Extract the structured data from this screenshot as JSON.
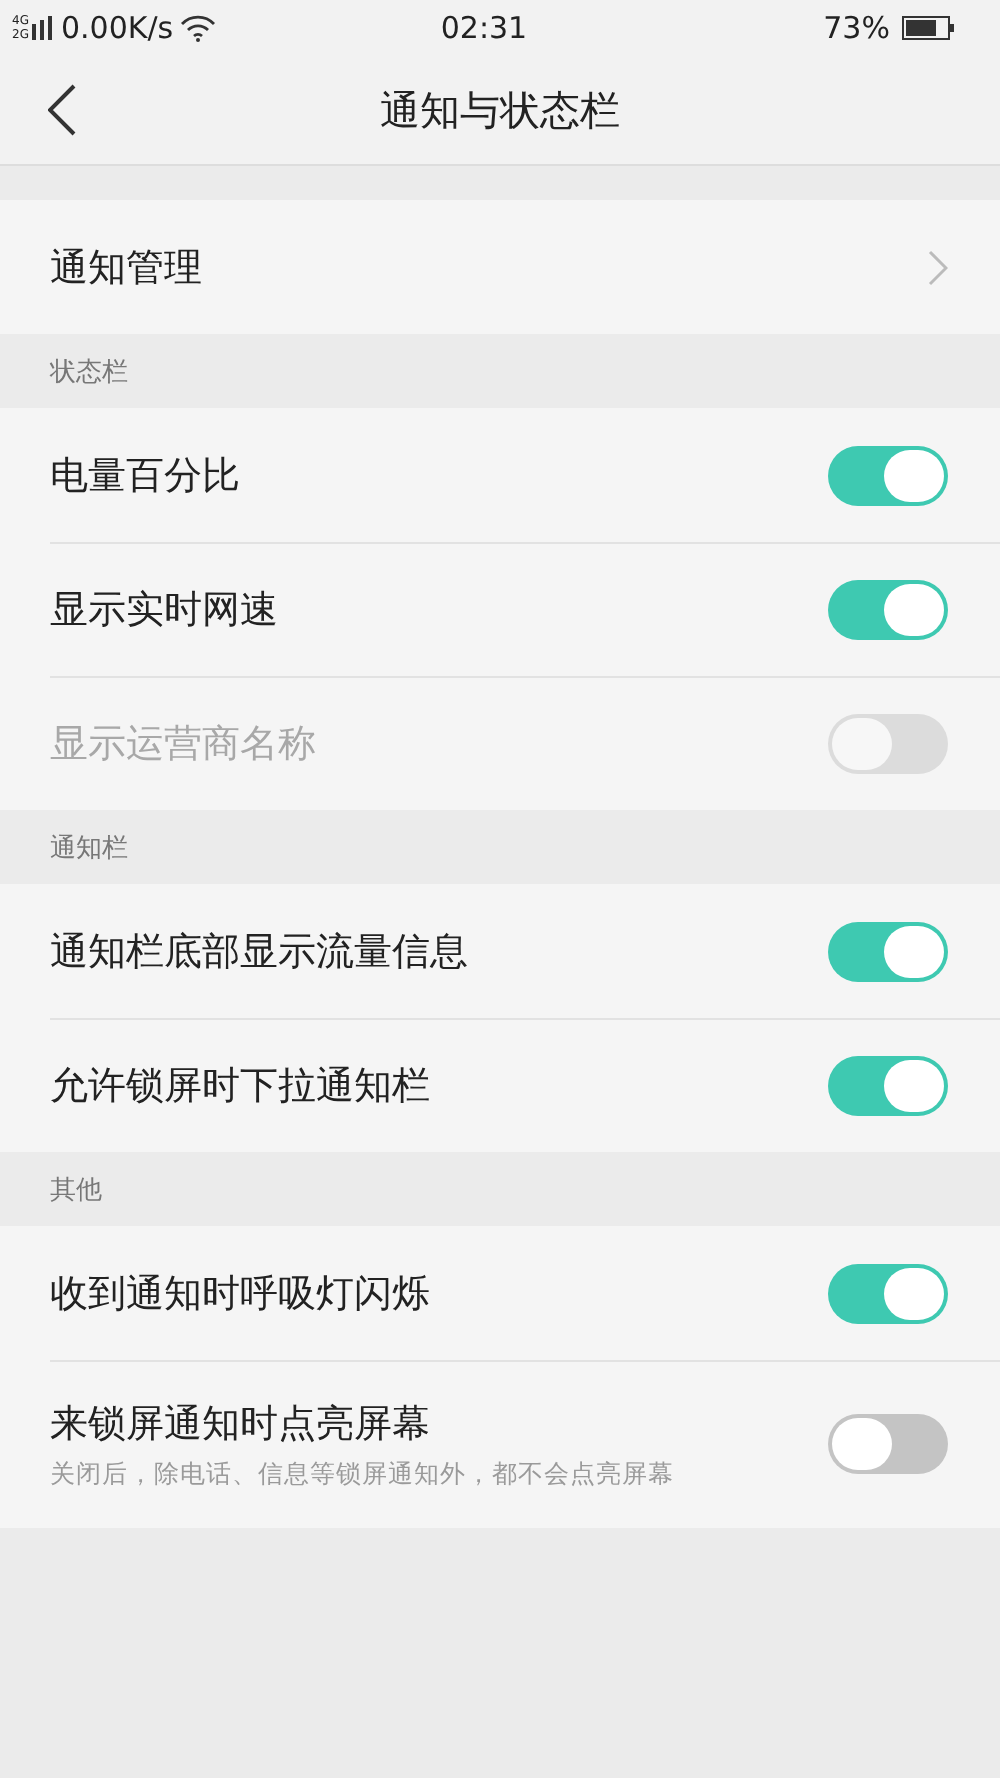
{
  "status_bar": {
    "network_top": "4G",
    "network_bottom": "2G",
    "speed": "0.00K/s",
    "time": "02:31",
    "battery": "73%"
  },
  "nav": {
    "title": "通知与状态栏"
  },
  "sections": [
    {
      "rows": [
        {
          "kind": "link",
          "label": "通知管理"
        }
      ]
    },
    {
      "header": "状态栏",
      "rows": [
        {
          "kind": "toggle",
          "label": "电量百分比",
          "on": true,
          "disabled": false
        },
        {
          "kind": "toggle",
          "label": "显示实时网速",
          "on": true,
          "disabled": false
        },
        {
          "kind": "toggle",
          "label": "显示运营商名称",
          "on": false,
          "disabled": true
        }
      ]
    },
    {
      "header": "通知栏",
      "rows": [
        {
          "kind": "toggle",
          "label": "通知栏底部显示流量信息",
          "on": true,
          "disabled": false
        },
        {
          "kind": "toggle",
          "label": "允许锁屏时下拉通知栏",
          "on": true,
          "disabled": false
        }
      ]
    },
    {
      "header": "其他",
      "rows": [
        {
          "kind": "toggle",
          "label": "收到通知时呼吸灯闪烁",
          "on": true,
          "disabled": false
        },
        {
          "kind": "toggle",
          "label": "来锁屏通知时点亮屏幕",
          "subtitle": "关闭后，除电话、信息等锁屏通知外，都不会点亮屏幕",
          "on": false,
          "disabled": false
        }
      ]
    }
  ]
}
